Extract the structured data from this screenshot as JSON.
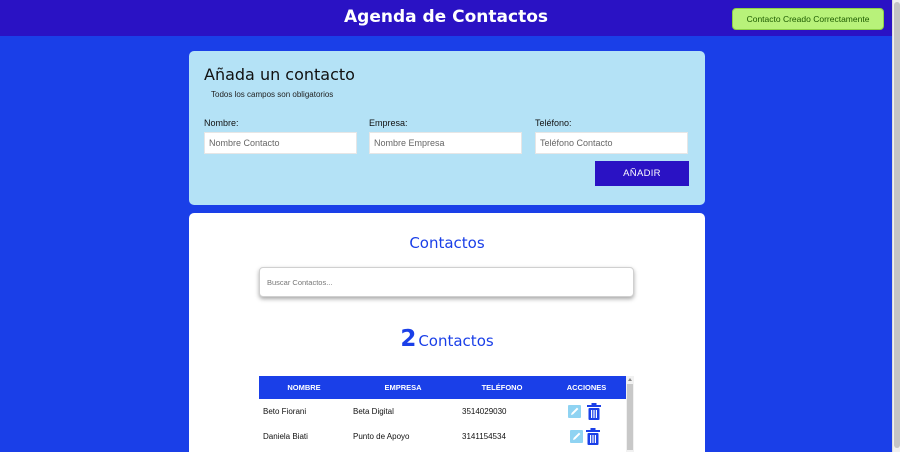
{
  "header": {
    "title": "Agenda de Contactos"
  },
  "toast": {
    "message": "Contacto Creado Correctamente"
  },
  "form": {
    "title": "Añada un contacto",
    "subtitle": "Todos los campos son obligatorios",
    "fields": [
      {
        "label": "Nombre:",
        "placeholder": "Nombre Contacto"
      },
      {
        "label": "Empresa:",
        "placeholder": "Nombre Empresa"
      },
      {
        "label": "Teléfono:",
        "placeholder": "Teléfono Contacto"
      }
    ],
    "submit_label": "AÑADIR"
  },
  "contacts": {
    "title": "Contactos",
    "search_placeholder": "Buscar Contactos...",
    "count": "2",
    "count_label": "Contactos",
    "columns": [
      "NOMBRE",
      "EMPRESA",
      "TELÉFONO",
      "ACCIONES"
    ],
    "rows": [
      {
        "nombre": "Beto Fiorani",
        "empresa": "Beta Digital",
        "telefono": "3514029030"
      },
      {
        "nombre": "Daniela Biati",
        "empresa": "Punto de Apoyo",
        "telefono": "3141154534"
      }
    ]
  },
  "icons": {
    "edit": "pencil-icon",
    "delete": "trash-icon"
  },
  "colors": {
    "accent": "#1a3fe8",
    "header": "#2a12c4",
    "form_bg": "#b4e2f6",
    "toast_bg": "#b8f27a"
  }
}
